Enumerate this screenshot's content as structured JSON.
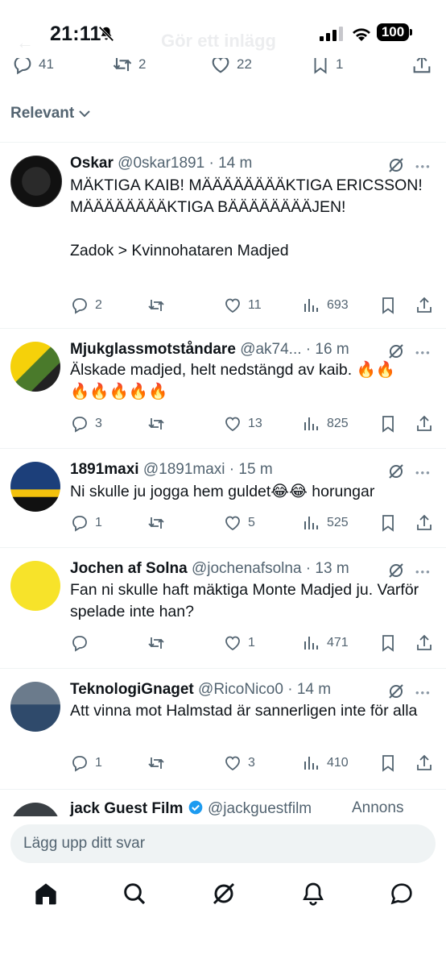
{
  "status_bar": {
    "time": "21:11",
    "battery": "100",
    "faded_title": "Gör ett inlägg"
  },
  "prev_actions": {
    "replies": "41",
    "reposts": "2",
    "likes": "22",
    "views": "1"
  },
  "sort": {
    "label": "Relevant"
  },
  "tweets": [
    {
      "name": "Oskar",
      "handle": "@0skar1891",
      "time": "14 m",
      "text": "MÄKTIGA KAIB! MÄÄÄÄÄÄÄÄKTIGA ERICSSON! MÄÄÄÄÄÄÄÄKTIGA BÄÄÄÄÄÄÄÄJEN!\n\nZadok > Kvinnohataren Madjed",
      "replies": "2",
      "reposts": "",
      "likes": "11",
      "views": "693"
    },
    {
      "name": "Mjukglassmotståndare",
      "handle": "@ak74...",
      "time": "16 m",
      "text": "Älskade madjed, helt nedstängd av kaib. 🔥🔥\n🔥🔥🔥🔥🔥",
      "replies": "3",
      "reposts": "",
      "likes": "13",
      "views": "825"
    },
    {
      "name": "1891maxi",
      "handle": "@1891maxi",
      "time": "15 m",
      "text": "Ni skulle ju jogga hem guldet😂😂 horungar",
      "replies": "1",
      "reposts": "",
      "likes": "5",
      "views": "525"
    },
    {
      "name": "Jochen af Solna",
      "handle": "@jochenafsolna",
      "time": "13 m",
      "text": "Fan ni skulle haft mäktiga Monte Madjed ju. Varför spelade inte han?",
      "replies": "",
      "reposts": "",
      "likes": "1",
      "views": "471"
    },
    {
      "name": "TeknologiGnaget",
      "handle": "@RicoNico0",
      "time": "14 m",
      "text": "Att vinna mot Halmstad är sannerligen inte för alla",
      "replies": "1",
      "reposts": "",
      "likes": "3",
      "views": "410"
    }
  ],
  "ad": {
    "name": "jack Guest Film",
    "handle": "@jackguestfilm",
    "label": "Annons"
  },
  "reply": {
    "placeholder": "Lägg upp ditt svar"
  },
  "colors": {
    "text": "#0f1419",
    "secondary": "#536471",
    "divider": "#eff3f4",
    "verified": "#1d9bf0"
  }
}
